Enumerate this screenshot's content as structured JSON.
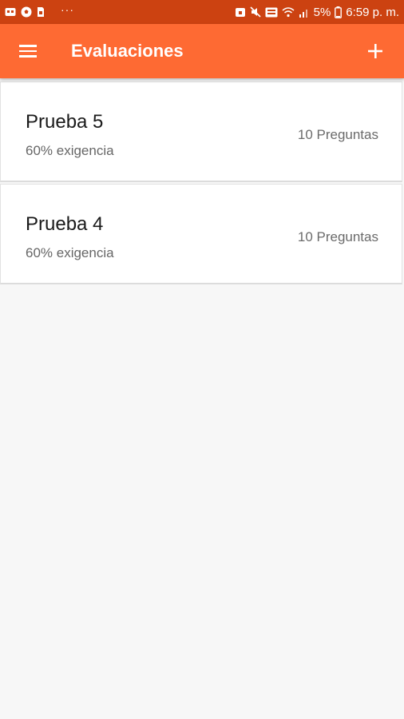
{
  "status_bar": {
    "dots": "···",
    "battery_percent": "5%",
    "time": "6:59 p. m.",
    "icons": [
      "messages-icon",
      "soccer-icon",
      "sim-icon",
      "lock-icon",
      "mute-icon",
      "volte-icon",
      "wifi-icon",
      "signal-icon",
      "battery-icon"
    ]
  },
  "app_bar": {
    "title": "Evaluaciones",
    "menu_icon": "hamburger-menu-icon",
    "add_icon": "plus-icon",
    "color": "#fe6a33"
  },
  "evaluations": [
    {
      "title": "Prueba 5",
      "requirement": "60% exigencia",
      "questions": "10 Preguntas"
    },
    {
      "title": "Prueba 4",
      "requirement": "60% exigencia",
      "questions": "10 Preguntas"
    }
  ]
}
